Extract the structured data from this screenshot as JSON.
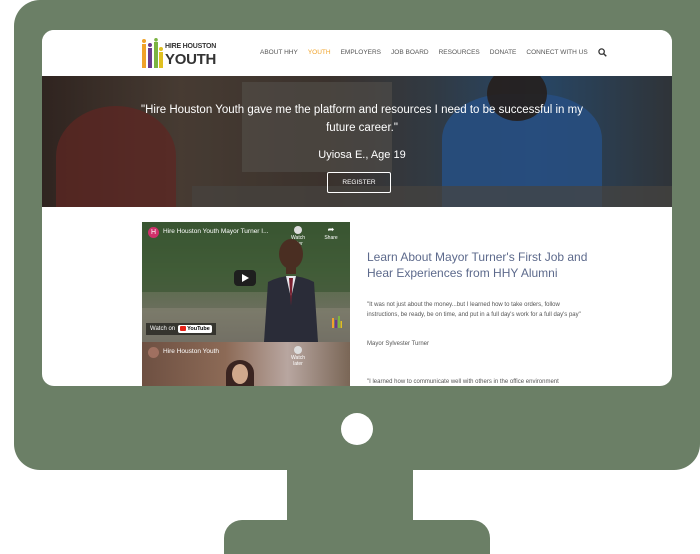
{
  "site": {
    "logo": {
      "line1": "HIRE HOUSTON",
      "line2": "YOUTH"
    },
    "nav": {
      "items": [
        {
          "label": "ABOUT HHY",
          "active": false
        },
        {
          "label": "YOUTH",
          "active": true
        },
        {
          "label": "EMPLOYERS",
          "active": false
        },
        {
          "label": "JOB BOARD",
          "active": false
        },
        {
          "label": "RESOURCES",
          "active": false
        },
        {
          "label": "DONATE",
          "active": false
        },
        {
          "label": "CONNECT WITH US",
          "active": false
        }
      ],
      "search_icon": "search-icon",
      "active_color": "#f0a32a"
    },
    "hero": {
      "quote": "\"Hire Houston Youth gave me the platform and resources I need to be successful in my future career.\"",
      "attribution": "Uyiosa E., Age 19",
      "cta": "REGISTER"
    },
    "videos": [
      {
        "channel_initial": "H",
        "title": "Hire Houston Youth Mayor Turner I...",
        "watch_later": "Watch later",
        "share": "Share",
        "watch_on": "Watch on",
        "youtube": "YouTube"
      },
      {
        "title": "Hire Houston Youth",
        "watch_later": "Watch later"
      }
    ],
    "content": {
      "heading": "Learn About Mayor Turner's First Job and Hear Experiences from HHY Alumni",
      "quote": "\"It was not just about the money...but I learned how to take orders, follow instructions, be ready, be on time, and put in a full day's work for a full day's pay\"",
      "author": "Mayor Sylvester Turner",
      "quote2": "\"I learned how to communicate well with others in the office environment"
    }
  },
  "colors": {
    "monitor": "#6b7f66",
    "heading": "#5d6a8c",
    "accent": "#f0a32a"
  }
}
